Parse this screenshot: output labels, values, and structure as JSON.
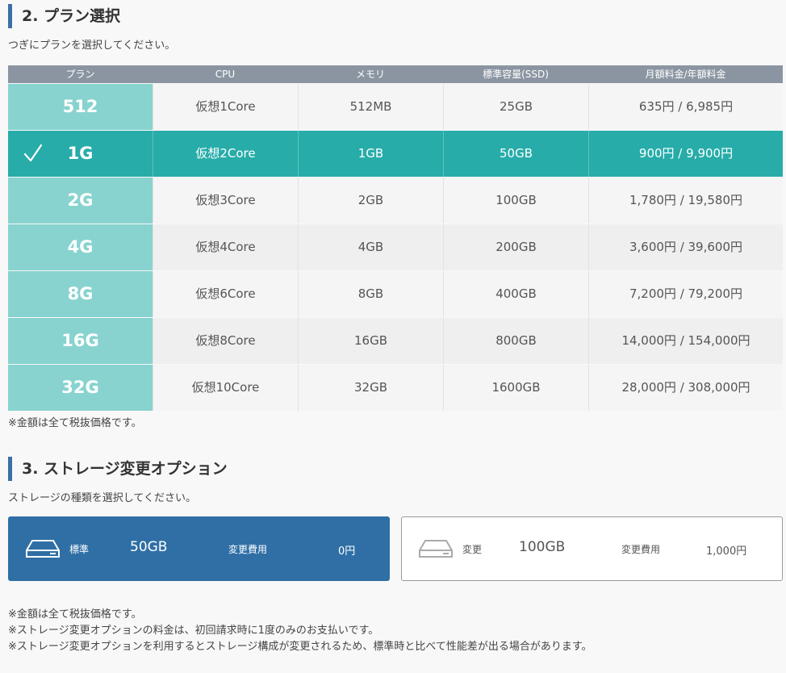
{
  "plan_section": {
    "title": "2. プラン選択",
    "instruction": "つぎにプランを選択してください。",
    "headers": [
      "プラン",
      "CPU",
      "メモリ",
      "標準容量(SSD)",
      "月額料金/年額料金"
    ],
    "rows": [
      {
        "name": "512",
        "cpu": "仮想1Core",
        "memory": "512MB",
        "storage": "25GB",
        "price": "635円 / 6,985円"
      },
      {
        "name": "1G",
        "cpu": "仮想2Core",
        "memory": "1GB",
        "storage": "50GB",
        "price": "900円 / 9,900円"
      },
      {
        "name": "2G",
        "cpu": "仮想3Core",
        "memory": "2GB",
        "storage": "100GB",
        "price": "1,780円 / 19,580円"
      },
      {
        "name": "4G",
        "cpu": "仮想4Core",
        "memory": "4GB",
        "storage": "200GB",
        "price": "3,600円 / 39,600円"
      },
      {
        "name": "8G",
        "cpu": "仮想6Core",
        "memory": "8GB",
        "storage": "400GB",
        "price": "7,200円 / 79,200円"
      },
      {
        "name": "16G",
        "cpu": "仮想8Core",
        "memory": "16GB",
        "storage": "800GB",
        "price": "14,000円 / 154,000円"
      },
      {
        "name": "32G",
        "cpu": "仮想10Core",
        "memory": "32GB",
        "storage": "1600GB",
        "price": "28,000円 / 308,000円"
      }
    ],
    "selected_plan": "1G",
    "tax_note": "※金額は全て税抜価格です。"
  },
  "storage_section": {
    "title": "3. ストレージ変更オプション",
    "instruction": "ストレージの種類を選択してください。",
    "options": [
      {
        "kind": "標準",
        "size": "50GB",
        "fee_label": "変更費用",
        "fee": "0円",
        "icon": "hard-drive-icon",
        "selected": true
      },
      {
        "kind": "変更",
        "size": "100GB",
        "fee_label": "変更費用",
        "fee": "1,000円",
        "icon": "hard-drive-icon",
        "selected": false
      }
    ]
  },
  "notes": [
    "※金額は全て税抜価格です。",
    "※ストレージ変更オプションの料金は、初回請求時に1度のみのお支払いです。",
    "※ストレージ変更オプションを利用するとストレージ構成が変更されるため、標準時と比べて性能差が出る場合があります。"
  ],
  "colors": {
    "accent_bar": "#3c6fa8",
    "plan_name_bg": "#88d3cf",
    "selected_row_bg": "#27aca9",
    "table_header_bg": "#8b95a2",
    "selected_storage_bg": "#2f6fa6"
  }
}
